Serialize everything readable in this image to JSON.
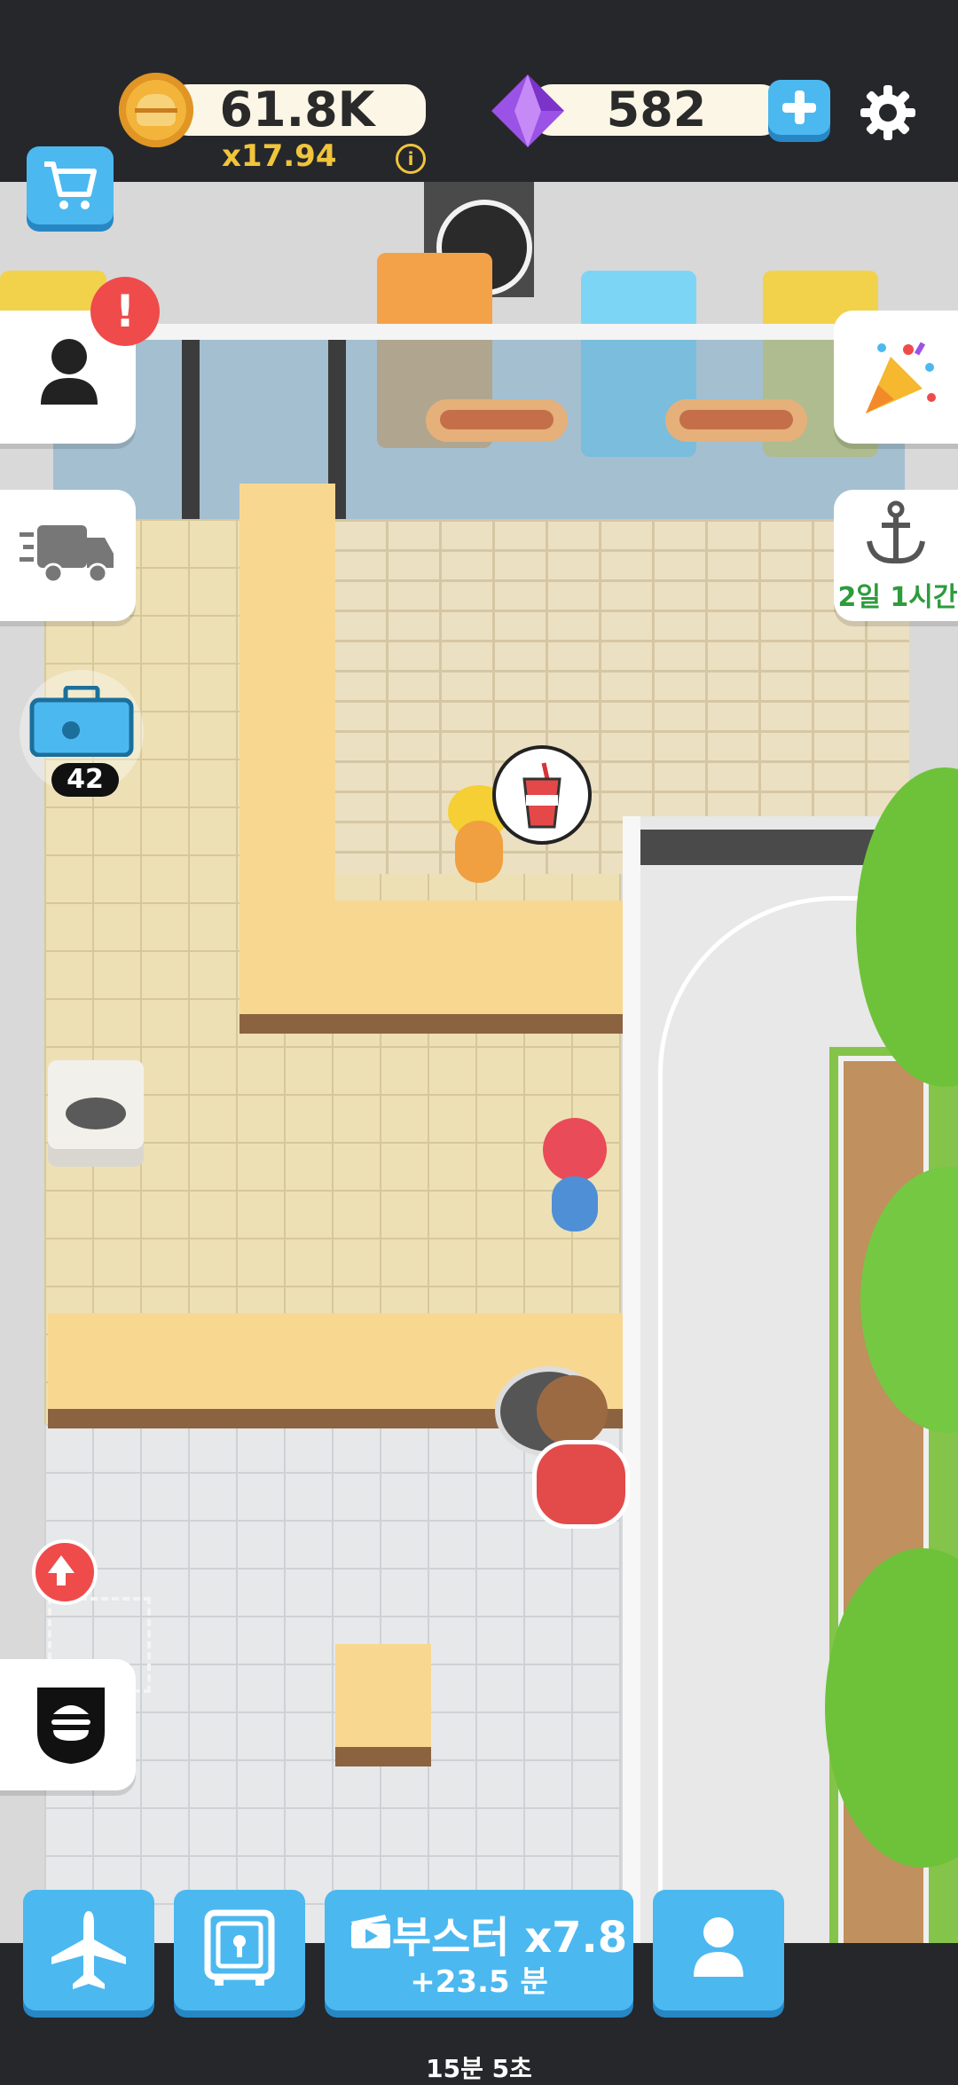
{
  "currency": {
    "coins": "61.8K",
    "multiplier": "x17.94",
    "gems": "582",
    "info_icon": "i"
  },
  "side_buttons": {
    "alert_badge": "!",
    "chest_count": "42",
    "harbor_timer": "2일 1시간"
  },
  "booster": {
    "label": "부스터 x7.8",
    "time_added": "+23.5 분"
  },
  "bottom_timer": "15분 5초",
  "colors": {
    "accent_blue": "#4cb8f0",
    "coin_gold": "#f2b43a",
    "gem_purple": "#9b52e6",
    "alert_red": "#ef4b4b",
    "timer_green": "#2e9b3d"
  },
  "icons": [
    "coin-icon",
    "gem-icon",
    "plus-icon",
    "gear-icon",
    "cart-icon",
    "person-icon",
    "delivery-truck-icon",
    "toolbox-icon",
    "party-popper-icon",
    "anchor-icon",
    "burger-badge-icon",
    "upgrade-arrow-icon",
    "airplane-icon",
    "vault-icon",
    "video-ad-icon",
    "profile-icon",
    "drink-cup-icon"
  ]
}
